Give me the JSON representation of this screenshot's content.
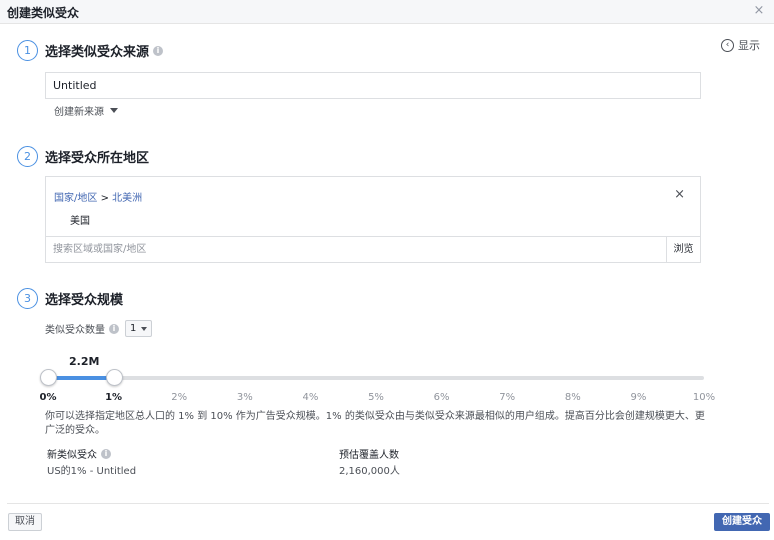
{
  "dialog": {
    "title": "创建类似受众",
    "close_glyph": "×",
    "show_label": "显示",
    "show_glyph": "‹"
  },
  "step1": {
    "number": "1",
    "label": "选择类似受众来源",
    "input_value": "Untitled",
    "create_source_label": "创建新来源"
  },
  "step2": {
    "number": "2",
    "label": "选择受众所在地区",
    "breadcrumb_country": "国家/地区",
    "breadcrumb_sep": ">",
    "breadcrumb_region": "北美洲",
    "selected_country": "美国",
    "remove_glyph": "×",
    "search_placeholder": "搜索区域或国家/地区",
    "browse_label": "浏览"
  },
  "step3": {
    "number": "3",
    "label": "选择受众规模",
    "quantity_label": "类似受众数量",
    "quantity_value": "1",
    "slider_value_label": "2.2M",
    "slider_range_percent": [
      0,
      1
    ],
    "ticks": [
      "0%",
      "1%",
      "2%",
      "3%",
      "4%",
      "5%",
      "6%",
      "7%",
      "8%",
      "9%",
      "10%"
    ],
    "description": "你可以选择指定地区总人口的 1% 到 10% 作为广告受众规模。1% 的类似受众由与类似受众来源最相似的用户组成。提高百分比会创建规模更大、更广泛的受众。"
  },
  "summary": {
    "col1_header": "新类似受众",
    "col2_header": "预估覆盖人数",
    "col1_value": "US的1% - Untitled",
    "col2_value": "2,160,000人"
  },
  "footer": {
    "cancel_label": "取消",
    "create_label": "创建受众"
  },
  "colors": {
    "accent": "#4a90e2",
    "primary_button": "#4267b2",
    "link": "#4267b2"
  }
}
